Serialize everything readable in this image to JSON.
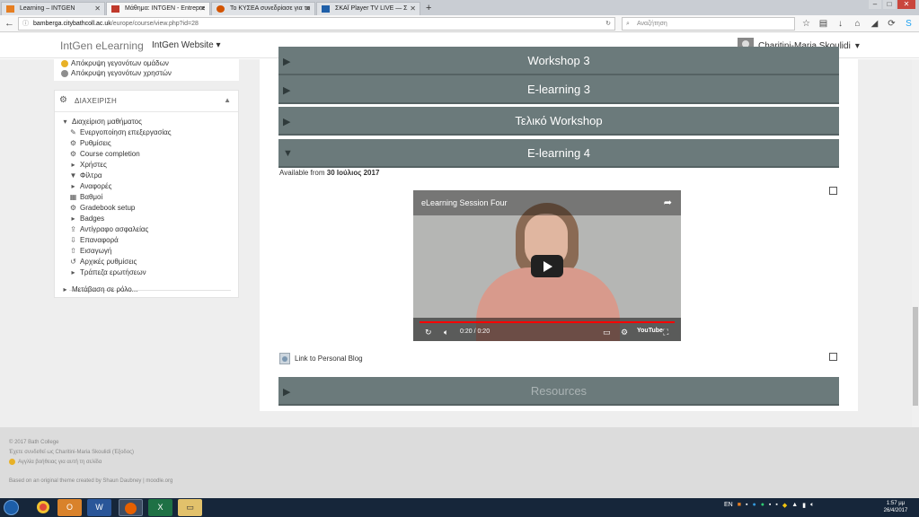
{
  "browser": {
    "tabs": [
      {
        "label": "Learning – INTGEN",
        "active": false
      },
      {
        "label": "Μάθημα: INTGEN - Entrepre",
        "active": true
      },
      {
        "label": "Το ΚΥΣΕΑ συνεδρίασε για το",
        "active": false
      },
      {
        "label": "ΣΚΑΪ Player TV LIVE — Σ",
        "active": false
      }
    ],
    "new_tab": "+",
    "url_host": "bamberga.citybathcoll.ac.uk",
    "url_path": "/europe/course/view.php?id=28",
    "search_placeholder": "Αναζήτηση"
  },
  "header": {
    "brand": "IntGen eLearning",
    "site_menu": "IntGen Website",
    "user_name": "Charitini-Maria Skoulidi"
  },
  "sidebar": {
    "top_items": [
      "Απόκρυψη γεγονότων ομάδων",
      "Απόκρυψη γεγονότων χρηστών"
    ],
    "admin_title": "ΔΙΑΧΕΙΡΙΣΗ",
    "course_admin": "Διαχείριση μαθήματος",
    "items": [
      {
        "label": "Ενεργοποίηση επεξεργασίας",
        "icon": "pencil-icon"
      },
      {
        "label": "Ρυθμίσεις",
        "icon": "gear-icon"
      },
      {
        "label": "Course completion",
        "icon": "gear-icon"
      },
      {
        "label": "Χρήστες",
        "icon": "chevron-right-icon"
      },
      {
        "label": "Φίλτρα",
        "icon": "filter-icon"
      },
      {
        "label": "Αναφορές",
        "icon": "chevron-right-icon"
      },
      {
        "label": "Βαθμοί",
        "icon": "grades-icon"
      },
      {
        "label": "Gradebook setup",
        "icon": "gear-icon"
      },
      {
        "label": "Badges",
        "icon": "chevron-right-icon"
      },
      {
        "label": "Αντίγραφο ασφαλείας",
        "icon": "backup-icon"
      },
      {
        "label": "Επαναφορά",
        "icon": "restore-icon"
      },
      {
        "label": "Εισαγωγή",
        "icon": "import-icon"
      },
      {
        "label": "Αρχικές ρυθμίσεις",
        "icon": "reset-icon"
      },
      {
        "label": "Τράπεζα ερωτήσεων",
        "icon": "chevron-right-icon"
      }
    ],
    "switch_role": "Μετάβαση σε ρόλο..."
  },
  "main": {
    "sections": [
      {
        "title": "Workshop 3",
        "faded": false
      },
      {
        "title": "E-learning 3",
        "faded": false
      },
      {
        "title": "Τελικό Workshop",
        "faded": false
      },
      {
        "title": "E-learning 4",
        "faded": false
      }
    ],
    "available_prefix": "Available from",
    "available_date": "30 Ιούλιος 2017",
    "video": {
      "title": "eLearning Session Four",
      "time": "0:20 / 0:20",
      "youtube": "YouTube"
    },
    "blog_link": "Link to Personal Blog",
    "resources": {
      "title": "Resources",
      "faded": true
    }
  },
  "footer": {
    "copyright": "© 2017 Bath College",
    "logged_in": "Έχετε συνδεθεί ως Charitini-Maria Skoulidi (Έξοδος)",
    "help": "Αγγλία βοήθειας για αυτή τη σελίδα",
    "theme": "Based on an original theme created by Shaun Daubney | moodle.org"
  },
  "taskbar": {
    "lang": "EN",
    "time": "1:57 μμ",
    "date": "26/4/2017"
  },
  "colors": {
    "section_bar": "#6b7a7b",
    "progress": "#ff0000"
  }
}
